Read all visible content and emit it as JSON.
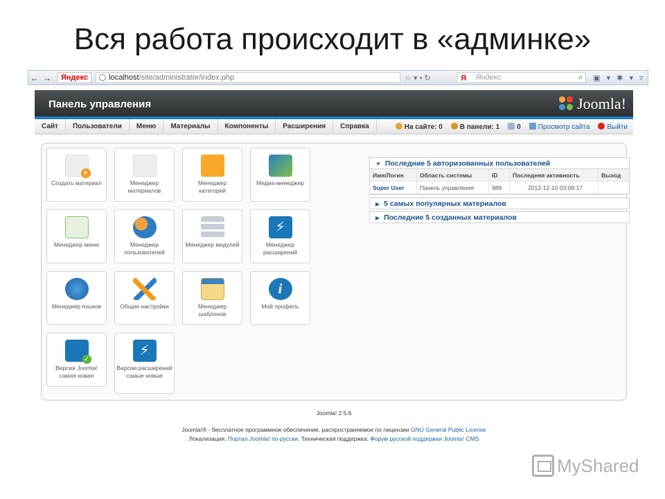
{
  "slide": {
    "title": "Вся работа происходит в «админке»"
  },
  "browser": {
    "back": "←",
    "forward": "→",
    "yandex_badge": "Яндекс",
    "url_host": "localhost",
    "url_path": "/site/administrator/index.php",
    "url_tools": "☆ ▾ • ↻",
    "search_logo": "Я",
    "search_placeholder": "Яндекс",
    "search_icon": "⌕",
    "ext_icons": "▣ ▾ ✱ ▾ ▿"
  },
  "app": {
    "header_title": "Панель управления",
    "logo_text": "Joomla!",
    "menu": [
      "Сайт",
      "Пользователи",
      "Меню",
      "Материалы",
      "Компоненты",
      "Расширения",
      "Справка"
    ],
    "status": {
      "on_site": "На сайте: 0",
      "in_panel": "В панели: 1",
      "messages": "0",
      "view_site": "Просмотр сайта",
      "logout": "Выйти"
    },
    "tiles": [
      {
        "label": "Создать материал",
        "icon": "new-article-icon"
      },
      {
        "label": "Менеджер материалов",
        "icon": "articles-icon"
      },
      {
        "label": "Менеджер категорий",
        "icon": "folder-icon"
      },
      {
        "label": "Медиа-менеджер",
        "icon": "media-icon"
      },
      {
        "label": "Менеджер меню",
        "icon": "menu-manager-icon"
      },
      {
        "label": "Менеджер пользователей",
        "icon": "users-icon"
      },
      {
        "label": "Менеджер модулей",
        "icon": "modules-icon"
      },
      {
        "label": "Менеджер расширений",
        "icon": "extensions-icon"
      },
      {
        "label": "Менеджер языков",
        "icon": "globe-icon"
      },
      {
        "label": "Общие настройки",
        "icon": "tools-icon"
      },
      {
        "label": "Менеджер шаблонов",
        "icon": "templates-icon"
      },
      {
        "label": "Мой профиль",
        "icon": "info-icon"
      },
      {
        "label": "Версия Joomla! самая новая",
        "icon": "joomla-update-icon"
      },
      {
        "label": "Версии расширений самые новые",
        "icon": "extension-update-icon"
      }
    ],
    "panels": {
      "logged_users": {
        "title": "Последние 5 авторизованных пользователей",
        "columns": [
          "Имя/Логин",
          "Область системы",
          "ID",
          "Последняя активность",
          "Выход"
        ],
        "rows": [
          [
            "Super User",
            "Панель управления",
            "989",
            "2012-12-10 03:09:17",
            ""
          ]
        ]
      },
      "popular": "5 самых популярных материалов",
      "latest": "Последние 5 созданных материалов"
    }
  },
  "footer": {
    "version": "Joomla! 2.5.6",
    "license_prefix": "Joomla!® - бесплатное программное обеспечение, распространяемое по лицензии",
    "license_link": "GNU General Public License",
    "loc_prefix": "Локализация:",
    "loc_link": "Портал Joomla! по-русски",
    "support_prefix": ". Техническая поддержка:",
    "support_link": "Форум русской поддержки Joomla! CMS"
  },
  "watermark": {
    "text": "MyShared"
  }
}
